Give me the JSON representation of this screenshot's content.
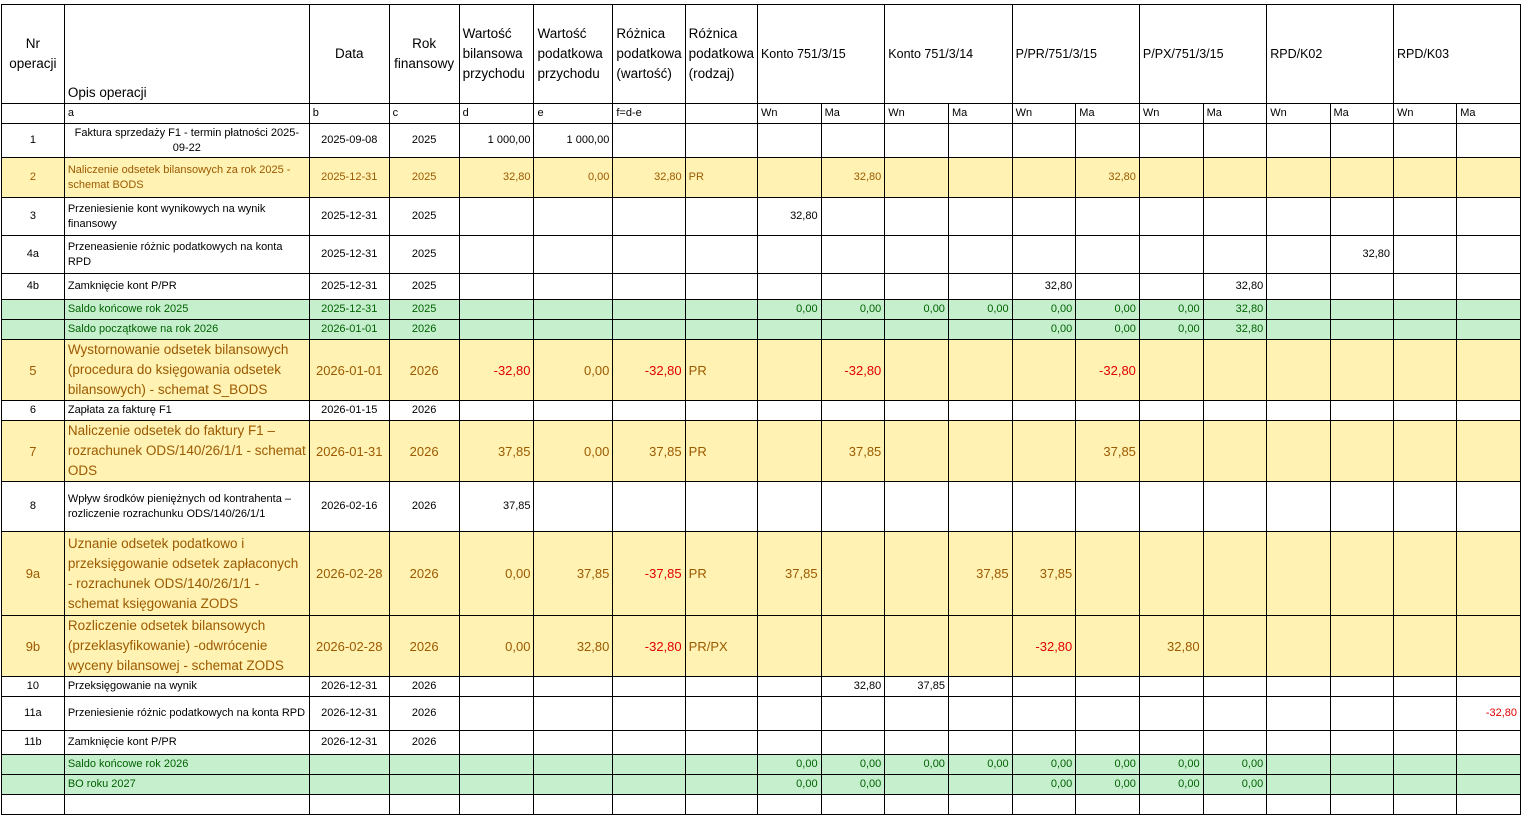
{
  "header": {
    "nr": "Nr operacji",
    "opis": "Opis operacji",
    "data": "Data",
    "rok": "Rok finansowy",
    "wart_bil": "Wartość bilansowa przychodu",
    "wart_pod": "Wartość podatkowa przychodu",
    "roz_wart": "Różnica podatkowa (wartość)",
    "roz_rodz": "Różnica podatkowa (rodzaj)",
    "accounts": [
      "Konto 751/3/15",
      "Konto 751/3/14",
      "P/PR/751/3/15",
      "P/PX/751/3/15",
      "RPD/K02",
      "RPD/K03"
    ]
  },
  "subheader": [
    "",
    "a",
    "b",
    "c",
    "d",
    "e",
    "f=d-e",
    "",
    "Wn",
    "Ma",
    "Wn",
    "Ma",
    "Wn",
    "Ma",
    "Wn",
    "Ma",
    "Wn",
    "Ma",
    "Wn",
    "Ma"
  ],
  "rows": [
    [
      "1",
      "Faktura sprzedaży F1 - termin płatności 2025-09-22",
      "2025-09-08",
      "2025",
      "1 000,00",
      "1 000,00",
      "",
      "",
      "",
      "",
      "",
      "",
      "",
      "",
      "",
      "",
      "",
      "",
      "",
      ""
    ],
    [
      "2",
      "Naliczenie odsetek bilansowych za rok 2025 - schemat BODS",
      "2025-12-31",
      "2025",
      "32,80",
      "0,00",
      "32,80",
      "PR",
      "",
      "32,80",
      "",
      "",
      "",
      "32,80",
      "",
      "",
      "",
      "",
      "",
      ""
    ],
    [
      "3",
      "Przeniesienie kont wynikowych na wynik finansowy",
      "2025-12-31",
      "2025",
      "",
      "",
      "",
      "",
      "32,80",
      "",
      "",
      "",
      "",
      "",
      "",
      "",
      "",
      "",
      "",
      ""
    ],
    [
      "4a",
      "Przeneasienie różnic podatkowych na konta RPD",
      "2025-12-31",
      "2025",
      "",
      "",
      "",
      "",
      "",
      "",
      "",
      "",
      "",
      "",
      "",
      "",
      "",
      "32,80",
      "",
      ""
    ],
    [
      "4b",
      "Zamknięcie kont P/PR",
      "2025-12-31",
      "2025",
      "",
      "",
      "",
      "",
      "",
      "",
      "",
      "",
      "32,80",
      "",
      "",
      "32,80",
      "",
      "",
      "",
      ""
    ],
    [
      "",
      "Saldo końcowe rok 2025",
      "2025-12-31",
      "2025",
      "",
      "",
      "",
      "",
      "0,00",
      "0,00",
      "0,00",
      "0,00",
      "0,00",
      "0,00",
      "0,00",
      "32,80",
      "",
      "",
      "",
      ""
    ],
    [
      "",
      "Saldo początkowe na rok 2026",
      "2026-01-01",
      "2026",
      "",
      "",
      "",
      "",
      "",
      "",
      "",
      "",
      "0,00",
      "0,00",
      "0,00",
      "32,80",
      "",
      "",
      "",
      ""
    ],
    [
      "5",
      "Wystornowanie odsetek bilansowych (procedura do księgowania odsetek bilansowych) - schemat S_BODS",
      "2026-01-01",
      "2026",
      "-32,80",
      "0,00",
      "-32,80",
      "PR",
      "",
      "-32,80",
      "",
      "",
      "",
      "-32,80",
      "",
      "",
      "",
      "",
      "",
      ""
    ],
    [
      "6",
      "Zapłata za fakturę F1",
      "2026-01-15",
      "2026",
      "",
      "",
      "",
      "",
      "",
      "",
      "",
      "",
      "",
      "",
      "",
      "",
      "",
      "",
      "",
      ""
    ],
    [
      "7",
      "Naliczenie odsetek do faktury F1 – rozrachunek ODS/140/26/1/1 - schemat ODS",
      "2026-01-31",
      "2026",
      "37,85",
      "0,00",
      "37,85",
      "PR",
      "",
      "37,85",
      "",
      "",
      "",
      "37,85",
      "",
      "",
      "",
      "",
      "",
      ""
    ],
    [
      "8",
      "Wpływ środków pieniężnych od kontrahenta – rozliczenie rozrachunku ODS/140/26/1/1",
      "2026-02-16",
      "2026",
      "37,85",
      "",
      "",
      "",
      "",
      "",
      "",
      "",
      "",
      "",
      "",
      "",
      "",
      "",
      "",
      ""
    ],
    [
      "9a",
      "Uznanie odsetek podatkowo i przeksięgowanie odsetek zapłaconych - rozrachunek ODS/140/26/1/1 - schemat księgowania ZODS",
      "2026-02-28",
      "2026",
      "0,00",
      "37,85",
      "-37,85",
      "PR",
      "37,85",
      "",
      "",
      "37,85",
      "37,85",
      "",
      "",
      "",
      "",
      "",
      "",
      ""
    ],
    [
      "9b",
      "Rozliczenie odsetek bilansowych (przeklasyfikowanie) -odwrócenie wyceny bilansowej - schemat ZODS",
      "2026-02-28",
      "2026",
      "0,00",
      "32,80",
      "-32,80",
      "PR/PX",
      "",
      "",
      "",
      "",
      "-32,80",
      "",
      "32,80",
      "",
      "",
      "",
      "",
      ""
    ],
    [
      "10",
      "Przeksięgowanie na wynik",
      "2026-12-31",
      "2026",
      "",
      "",
      "",
      "",
      "",
      "32,80",
      "37,85",
      "",
      "",
      "",
      "",
      "",
      "",
      "",
      "",
      ""
    ],
    [
      "11a",
      "Przeniesienie różnic podatkowych na konta RPD",
      "2026-12-31",
      "2026",
      "",
      "",
      "",
      "",
      "",
      "",
      "",
      "",
      "",
      "",
      "",
      "",
      "",
      "",
      "",
      "-32,80"
    ],
    [
      "11b",
      "Zamknięcie kont P/PR",
      "2026-12-31",
      "2026",
      "",
      "",
      "",
      "",
      "",
      "",
      "",
      "",
      "",
      "",
      "",
      "",
      "",
      "",
      "",
      ""
    ],
    [
      "",
      "Saldo końcowe rok 2026",
      "",
      "",
      "",
      "",
      "",
      "",
      "0,00",
      "0,00",
      "0,00",
      "0,00",
      "0,00",
      "0,00",
      "0,00",
      "0,00",
      "",
      "",
      "",
      ""
    ],
    [
      "",
      "BO roku 2027",
      "",
      "",
      "",
      "",
      "",
      "",
      "0,00",
      "0,00",
      "",
      "",
      "0,00",
      "0,00",
      "0,00",
      "0,00",
      "",
      "",
      "",
      ""
    ],
    [
      "",
      "",
      "",
      "",
      "",
      "",
      "",
      "",
      "",
      "",
      "",
      "",
      "",
      "",
      "",
      "",
      "",
      "",
      "",
      ""
    ]
  ]
}
